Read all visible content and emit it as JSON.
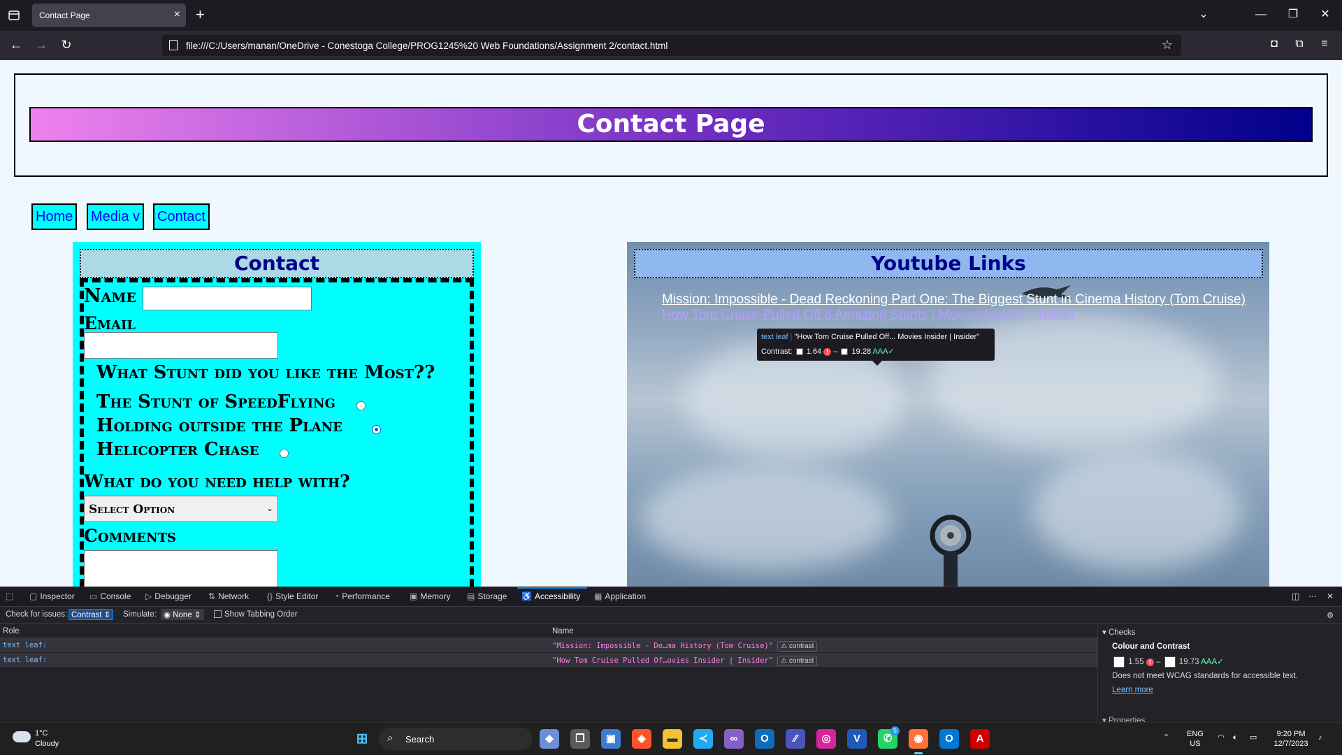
{
  "browser": {
    "tab_title": "Contact Page",
    "url": "file:///C:/Users/manan/OneDrive - Conestoga College/PROG1245%20 Web Foundations/Assignment 2/contact.html"
  },
  "page": {
    "banner_title": "Contact Page",
    "menu": [
      "Home",
      "Media v",
      "Contact"
    ],
    "contact": {
      "heading": "Contact",
      "name_label": "Name",
      "email_label": "Email",
      "question": "What Stunt did you like the Most??",
      "options": [
        "The Stunt of SpeedFlying",
        "Holding outside the Plane",
        "Helicopter Chase"
      ],
      "selected_option_index": 1,
      "help_label": "What do you need help with?",
      "select_value": "Select Option",
      "comments_label": "Comments"
    },
    "youtube": {
      "heading": "Youtube Links",
      "links": [
        "Mission: Impossible - Dead Reckoning Part One: The Biggest Stunt in Cinema History (Tom Cruise)",
        "How Tom Cruise Pulled Off 8 Amazing Stunts | Movies Insider | Insider"
      ]
    },
    "tooltip": {
      "role": "text leaf",
      "name": "\"How Tom Cruise Pulled Off... Movies Insider | Insider\"",
      "contrast_label": "Contrast:",
      "contrast_low": "1.64",
      "contrast_high": "19.28",
      "grade": "AAA✓"
    }
  },
  "devtools": {
    "tabs": [
      "Inspector",
      "Console",
      "Debugger",
      "Network",
      "Style Editor",
      "Performance",
      "Memory",
      "Storage",
      "Accessibility",
      "Application"
    ],
    "active_tab": "Accessibility",
    "check_label": "Check for issues:",
    "check_value": "Contrast",
    "simulate_label": "Simulate:",
    "simulate_value": "None",
    "tabbing_label": "Show Tabbing Order",
    "col_role": "Role",
    "col_name": "Name",
    "rows": [
      {
        "role": "text leaf:",
        "name": "\"Mission: Impossible - De…ma History (Tom Cruise)\"",
        "badge": "contrast"
      },
      {
        "role": "text leaf:",
        "name": "\"How Tom Cruise Pulled Of…ovies Insider | Insider\"",
        "badge": "contrast"
      }
    ],
    "sidebar": {
      "title": "Checks",
      "subtitle": "Colour and Contrast",
      "low": "1.55",
      "high": "19.73",
      "grade": "AAA✓",
      "message": "Does not meet WCAG standards for accessible text.",
      "link": "Learn more",
      "properties": "Properties"
    }
  },
  "taskbar": {
    "temp": "1°C",
    "condition": "Cloudy",
    "search": "Search",
    "lang": "ENG",
    "region": "US",
    "time": "9:20 PM",
    "date": "12/7/2023",
    "whatsapp_badge": "5"
  },
  "colors": {
    "banner_start": "#ee82ee",
    "banner_end": "#00008b",
    "menu_bg": "#00ffff",
    "link_visited": "#b69dff",
    "contrast_fail": "#ff4f5e",
    "contrast_pass": "#54ffbd"
  }
}
